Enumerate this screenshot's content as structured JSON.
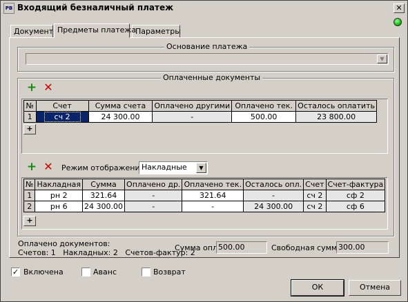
{
  "window": {
    "title": "Входящий безналичный платеж",
    "close_label": "✕"
  },
  "tabs": [
    {
      "label": "Документ"
    },
    {
      "label": "Предметы платежа"
    },
    {
      "label": "Параметры"
    }
  ],
  "basis": {
    "title": "Основание платежа",
    "value": ""
  },
  "paid": {
    "title": "Оплаченные документы",
    "columns": [
      "№",
      "Счет",
      "Сумма счета",
      "Оплачено другими",
      "Оплачено тек.",
      "Осталось оплатить"
    ],
    "rows": [
      {
        "n": "1",
        "account": "сч 2",
        "sum": "24 300.00",
        "paid_other": "-",
        "paid_cur": "500.00",
        "left": "23 800.00"
      }
    ]
  },
  "display_mode": {
    "label": "Режим отображения:",
    "value": "Накладные"
  },
  "invoices": {
    "columns": [
      "№",
      "Накладная",
      "Сумма",
      "Оплачено др.",
      "Оплачено тек.",
      "Осталось опл.",
      "Счет",
      "Счет-фактура"
    ],
    "rows": [
      {
        "n": "1",
        "waybill": "рн 2",
        "sum": "321.64",
        "paid_other": "-",
        "paid_cur": "321.64",
        "left": "-",
        "account": "сч 2",
        "invoice": "сф 2"
      },
      {
        "n": "2",
        "waybill": "рн 6",
        "sum": "24 300.00",
        "paid_other": "-",
        "paid_cur": "-",
        "left": "24 300.00",
        "account": "сч 2",
        "invoice": "сф 6"
      }
    ]
  },
  "summary": {
    "paid_docs_label": "Оплачено документов:",
    "counts_line": "Счетов: 1   Накладных: 2   Счетов-фактур: 2",
    "sum_paid_label": "Сумма опл:",
    "sum_paid_value": "500.00",
    "free_sum_label": "Свободная сумма:",
    "free_sum_value": "300.00"
  },
  "options": {
    "enabled_label": "Включена",
    "enabled_checked": "✓",
    "advance_label": "Аванс",
    "return_label": "Возврат"
  },
  "buttons": {
    "ok": "ОК",
    "cancel": "Отмена"
  },
  "icons": {
    "add": "+",
    "remove": "✕",
    "add_row": "+",
    "arrow_down": "▼"
  }
}
